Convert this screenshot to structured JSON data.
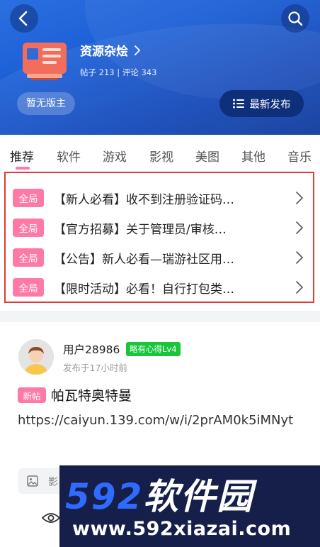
{
  "header": {
    "forum_name": "资源杂烩",
    "stats": "帖子 213 | 评论 343",
    "moderator_status": "暂无版主",
    "latest_button": "最新发布"
  },
  "tabs": [
    "推荐",
    "软件",
    "游戏",
    "影视",
    "美图",
    "其他",
    "音乐"
  ],
  "pinned": [
    {
      "badge": "全局",
      "title": "【新人必看】收不到注册验证码…"
    },
    {
      "badge": "全局",
      "title": "【官方招募】关于管理员/审核…"
    },
    {
      "badge": "全局",
      "title": "【公告】新人必看—瑞游社区用…"
    },
    {
      "badge": "全局",
      "title": "【限时活动】必看！自行打包类…"
    }
  ],
  "post": {
    "username": "用户28986",
    "level": "略有心得Lv4",
    "time": "发布于17小时前",
    "new_badge": "新帖",
    "title": "帕瓦特奥特曼",
    "body": "https://caiyun.139.com/w/i/2prAM0k5iMNyt",
    "attachment_label": "影"
  },
  "watermark": {
    "number": "592",
    "chinese": "软件园",
    "url": "www.592xiazai.com"
  },
  "colors": {
    "header_blue": "#1c5fd6",
    "accent_pink": "#ff79a6",
    "level_green": "#19c63a",
    "highlight_red": "#e53935"
  }
}
